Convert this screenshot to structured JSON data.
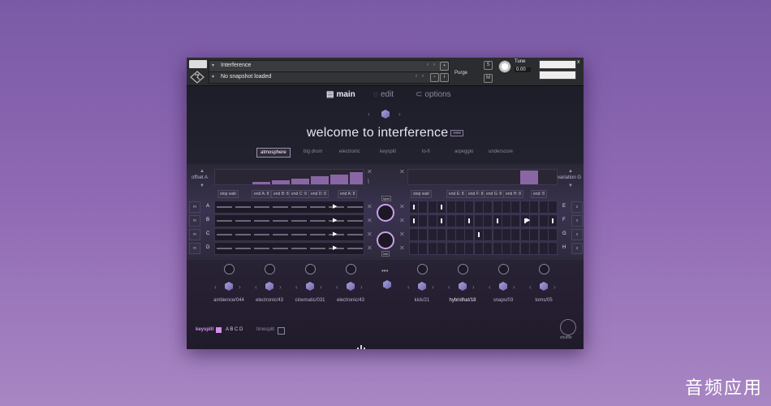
{
  "header": {
    "instrument_name": "Interference",
    "snapshot_text": "No snapshot loaded",
    "purge_label": "Purge",
    "tune_label": "Tune",
    "tune_value": "0.00",
    "close_glyph": "x"
  },
  "nav": {
    "main_label": "main",
    "edit_label": "edit",
    "options_label": "options"
  },
  "title": {
    "text": "welcome to interference",
    "badge": "new"
  },
  "presets": [
    "atmosphere",
    "big drum",
    "electronic",
    "keysplit",
    "lo-fi",
    "arpeggio",
    "underscore"
  ],
  "selected_preset": "atmosphere",
  "offset": {
    "label": "offset",
    "letter": "A"
  },
  "variation": {
    "label": "variation",
    "letter": "G"
  },
  "tags_left": [
    "stop wait",
    "end A: 8",
    "end B: 8",
    "end C: 8",
    "end D: 8",
    "end A: 8"
  ],
  "tags_right": [
    "stop wait",
    "end E: 8",
    "end F: 8",
    "end G: 8",
    "end H: 8",
    "end: 8"
  ],
  "rows_left": [
    "A",
    "B",
    "C",
    "D"
  ],
  "rows_right": [
    "E",
    "F",
    "G",
    "H"
  ],
  "slots": [
    {
      "label": "ambience/044"
    },
    {
      "label": "electronic/43"
    },
    {
      "label": "cinematic/031"
    },
    {
      "label": "electronic/43"
    },
    {
      "label": "kick/21"
    },
    {
      "label": "hybridhat/18"
    },
    {
      "label": "snaps/03"
    },
    {
      "label": "toms/05"
    }
  ],
  "footer": {
    "keysplit_label": "keysplit",
    "keysplit_value": "A B C D",
    "timesplit_label": "timesplit",
    "shuffle_label": "shuffle"
  },
  "watermark": "音频应用",
  "colors": {
    "accent": "#c98ef0",
    "background_top": "#7a5aa6",
    "panel": "#1b1c26"
  }
}
